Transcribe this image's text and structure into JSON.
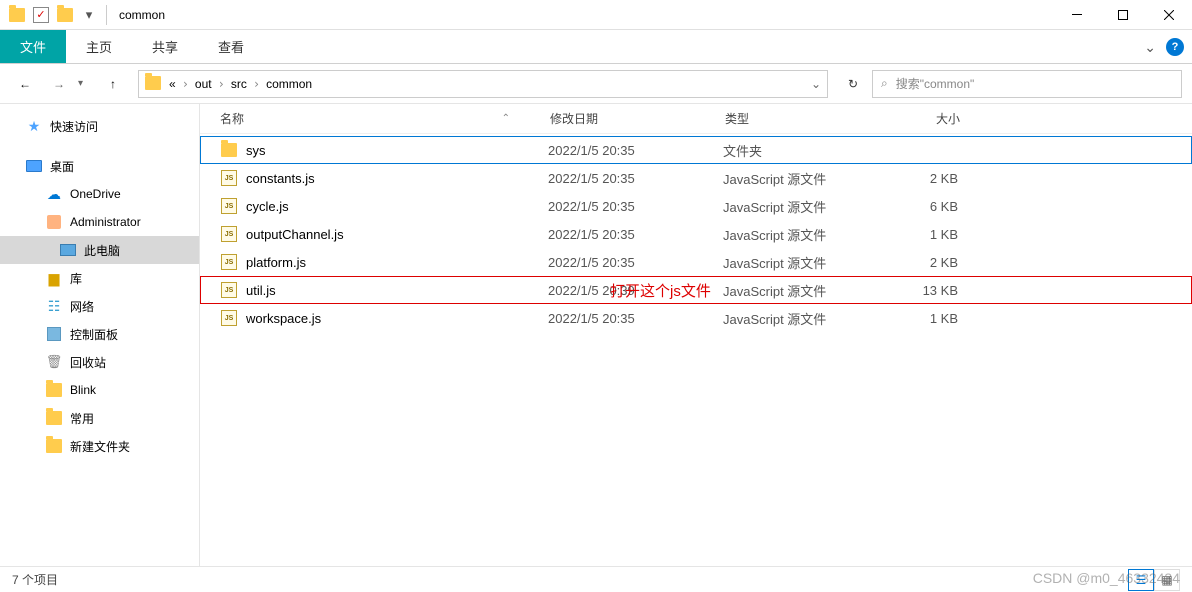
{
  "title_bar": {
    "title": "common"
  },
  "ribbon": {
    "file": "文件",
    "tabs": [
      "主页",
      "共享",
      "查看"
    ]
  },
  "nav": {
    "breadcrumb_prefix": "«",
    "crumbs": [
      "out",
      "src",
      "common"
    ]
  },
  "search": {
    "placeholder": "搜索\"common\""
  },
  "sidebar": {
    "items": [
      {
        "label": "快速访问",
        "icon": "star",
        "indent": 0,
        "sep": true
      },
      {
        "label": "桌面",
        "icon": "monitor",
        "indent": 0
      },
      {
        "label": "OneDrive",
        "icon": "cloud",
        "indent": 1
      },
      {
        "label": "Administrator",
        "icon": "user",
        "indent": 1
      },
      {
        "label": "此电脑",
        "icon": "pc",
        "indent": 2,
        "selected": true
      },
      {
        "label": "库",
        "icon": "lib",
        "indent": 1
      },
      {
        "label": "网络",
        "icon": "net",
        "indent": 1
      },
      {
        "label": "控制面板",
        "icon": "panel",
        "indent": 1
      },
      {
        "label": "回收站",
        "icon": "bin",
        "indent": 1
      },
      {
        "label": "Blink",
        "icon": "folder",
        "indent": 1
      },
      {
        "label": "常用",
        "icon": "folder",
        "indent": 1
      },
      {
        "label": "新建文件夹",
        "icon": "folder",
        "indent": 1
      }
    ]
  },
  "columns": {
    "name": "名称",
    "date": "修改日期",
    "type": "类型",
    "size": "大小"
  },
  "files": [
    {
      "name": "sys",
      "date": "2022/1/5 20:35",
      "type": "文件夹",
      "size": "",
      "icon": "folder",
      "selected": true
    },
    {
      "name": "constants.js",
      "date": "2022/1/5 20:35",
      "type": "JavaScript 源文件",
      "size": "2 KB",
      "icon": "js"
    },
    {
      "name": "cycle.js",
      "date": "2022/1/5 20:35",
      "type": "JavaScript 源文件",
      "size": "6 KB",
      "icon": "js"
    },
    {
      "name": "outputChannel.js",
      "date": "2022/1/5 20:35",
      "type": "JavaScript 源文件",
      "size": "1 KB",
      "icon": "js"
    },
    {
      "name": "platform.js",
      "date": "2022/1/5 20:35",
      "type": "JavaScript 源文件",
      "size": "2 KB",
      "icon": "js"
    },
    {
      "name": "util.js",
      "date": "2022/1/5 20:39",
      "type": "JavaScript 源文件",
      "size": "13 KB",
      "icon": "js",
      "highlighted": true
    },
    {
      "name": "workspace.js",
      "date": "2022/1/5 20:35",
      "type": "JavaScript 源文件",
      "size": "1 KB",
      "icon": "js"
    }
  ],
  "annotation": "打开这个js文件",
  "status": {
    "count": "7 个项目"
  },
  "watermark": "CSDN @m0_46332434"
}
